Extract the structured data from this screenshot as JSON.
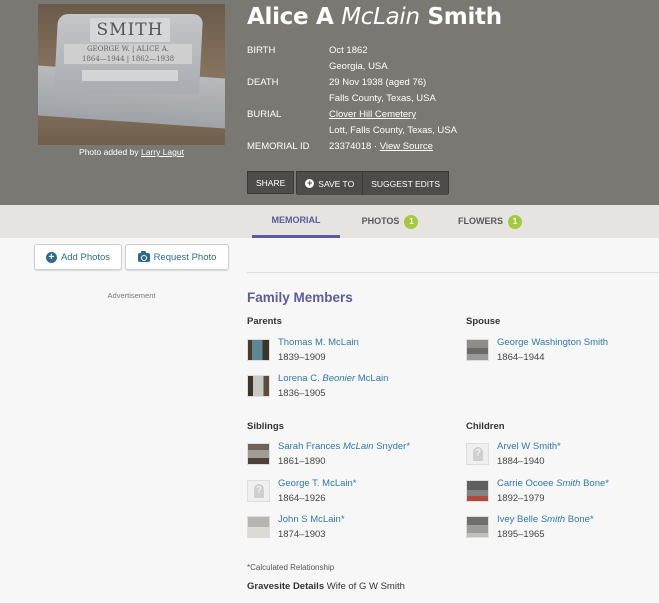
{
  "header": {
    "photo": {
      "alt": "Headstone photo",
      "stone_surname": "SMITH",
      "stone_line1": "GEORGE W.  |  ALICE A.",
      "stone_line2": "1864—1944  |  1862—1938",
      "caption_prefix": "Photo added by",
      "caption_author": "Larry Lagut"
    },
    "name": {
      "first": "Alice A",
      "maiden": "McLain",
      "last": "Smith"
    },
    "facts": [
      {
        "label": "BIRTH",
        "value": "Oct 1862"
      },
      {
        "label": "",
        "value": "Georgia, USA"
      },
      {
        "label": "DEATH",
        "value": "29 Nov 1938 (aged 76)"
      },
      {
        "label": "",
        "value": "Falls County, Texas, USA"
      },
      {
        "label": "BURIAL",
        "value": "Clover Hill Cemetery",
        "link": true
      },
      {
        "label": "",
        "value": "Lott, Falls County, Texas, USA"
      },
      {
        "label": "MEMORIAL ID",
        "value": "23374018",
        "separator": " · ",
        "link_text": "View Source"
      }
    ],
    "actions": {
      "share": "SHARE",
      "save_to": "SAVE TO",
      "suggest_edits": "SUGGEST EDITS"
    }
  },
  "tabs": [
    {
      "label": "MEMORIAL",
      "active": true
    },
    {
      "label": "PHOTOS",
      "badge": "1"
    },
    {
      "label": "FLOWERS",
      "badge": "1"
    }
  ],
  "sidebar": {
    "add_photos": "Add Photos",
    "request_photo": "Request Photo",
    "advertisement": "Advertisement"
  },
  "family": {
    "title": "Family Members",
    "parents": {
      "title": "Parents",
      "people": [
        {
          "name_pre": "Thomas M. McLain",
          "name_em": "",
          "name_post": "",
          "dates": "1839–1909"
        },
        {
          "name_pre": "Lorena C. ",
          "name_em": "Beonier",
          "name_post": " McLain",
          "dates": "1836–1905"
        }
      ]
    },
    "spouse": {
      "title": "Spouse",
      "people": [
        {
          "name_pre": "George Washington Smith",
          "name_em": "",
          "name_post": "",
          "dates": "1864–1944"
        }
      ]
    },
    "siblings": {
      "title": "Siblings",
      "people": [
        {
          "name_pre": "Sarah Frances ",
          "name_em": "McLain",
          "name_post": " Snyder*",
          "dates": "1861–1890"
        },
        {
          "name_pre": "George T. McLain*",
          "name_em": "",
          "name_post": "",
          "dates": "1864–1926"
        },
        {
          "name_pre": "John S McLain*",
          "name_em": "",
          "name_post": "",
          "dates": "1874–1903"
        }
      ]
    },
    "children": {
      "title": "Children",
      "people": [
        {
          "name_pre": "Arvel W Smith*",
          "name_em": "",
          "name_post": "",
          "dates": "1884–1940"
        },
        {
          "name_pre": "Carrie Ocoee ",
          "name_em": "Smith",
          "name_post": " Bone*",
          "dates": "1892–1979"
        },
        {
          "name_pre": "Ivey Belle ",
          "name_em": "Smith",
          "name_post": " Bone*",
          "dates": "1895–1965"
        }
      ]
    },
    "calculated_note": "*Calculated Relationship"
  },
  "gravesite": {
    "label": "Gravesite Details",
    "value": "Wife of G W Smith"
  },
  "colors": {
    "header_bg": "#7a7873",
    "tab_active": "#5a5aa8",
    "badge": "#a4c93a",
    "link": "#2f79a6",
    "section_title": "#5c5ca0"
  }
}
